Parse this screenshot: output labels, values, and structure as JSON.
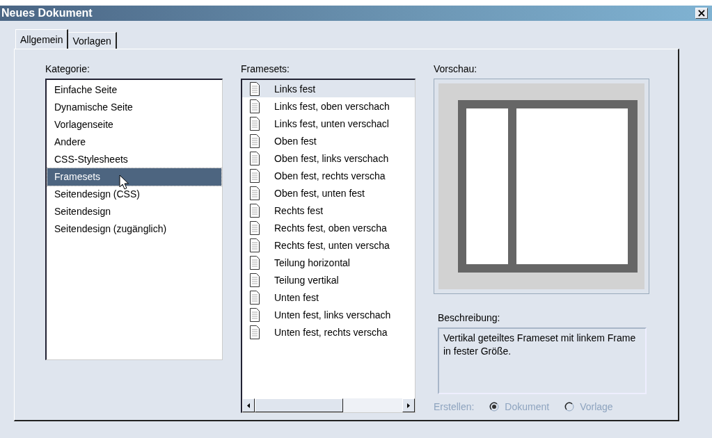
{
  "window": {
    "title": "Neues Dokument",
    "close": "×"
  },
  "tabs": [
    {
      "label": "Allgemein",
      "selected": true
    },
    {
      "label": "Vorlagen",
      "selected": false
    }
  ],
  "kategorie": {
    "label": "Kategorie:",
    "items": [
      {
        "label": "Einfache Seite",
        "selected": false
      },
      {
        "label": "Dynamische Seite",
        "selected": false
      },
      {
        "label": "Vorlagenseite",
        "selected": false
      },
      {
        "label": "Andere",
        "selected": false
      },
      {
        "label": "CSS-Stylesheets",
        "selected": false
      },
      {
        "label": "Framesets",
        "selected": true
      },
      {
        "label": "Seitendesign (CSS)",
        "selected": false
      },
      {
        "label": "Seitendesign",
        "selected": false
      },
      {
        "label": "Seitendesign (zugänglich)",
        "selected": false
      }
    ]
  },
  "framesets": {
    "label": "Framesets:",
    "items": [
      {
        "label": "Links fest",
        "selected": true
      },
      {
        "label": "Links fest, oben verschach",
        "selected": false
      },
      {
        "label": "Links fest, unten verschacl",
        "selected": false
      },
      {
        "label": "Oben fest",
        "selected": false
      },
      {
        "label": "Oben fest, links verschach",
        "selected": false
      },
      {
        "label": "Oben fest, rechts verscha",
        "selected": false
      },
      {
        "label": "Oben fest, unten fest",
        "selected": false
      },
      {
        "label": "Rechts fest",
        "selected": false
      },
      {
        "label": "Rechts fest, oben verscha",
        "selected": false
      },
      {
        "label": "Rechts fest, unten verscha",
        "selected": false
      },
      {
        "label": "Teilung horizontal",
        "selected": false
      },
      {
        "label": "Teilung vertikal",
        "selected": false
      },
      {
        "label": "Unten fest",
        "selected": false
      },
      {
        "label": "Unten fest, links verschach",
        "selected": false
      },
      {
        "label": "Unten fest, rechts verscha",
        "selected": false
      }
    ]
  },
  "vorschau": {
    "label": "Vorschau:"
  },
  "beschreibung": {
    "label": "Beschreibung:",
    "text": "Vertikal geteiltes Frameset mit linkem Frame in fester Größe."
  },
  "erstellen": {
    "label": "Erstellen:",
    "disabled": true,
    "options": [
      {
        "label": "Dokument",
        "selected": true
      },
      {
        "label": "Vorlage",
        "selected": false
      }
    ]
  }
}
